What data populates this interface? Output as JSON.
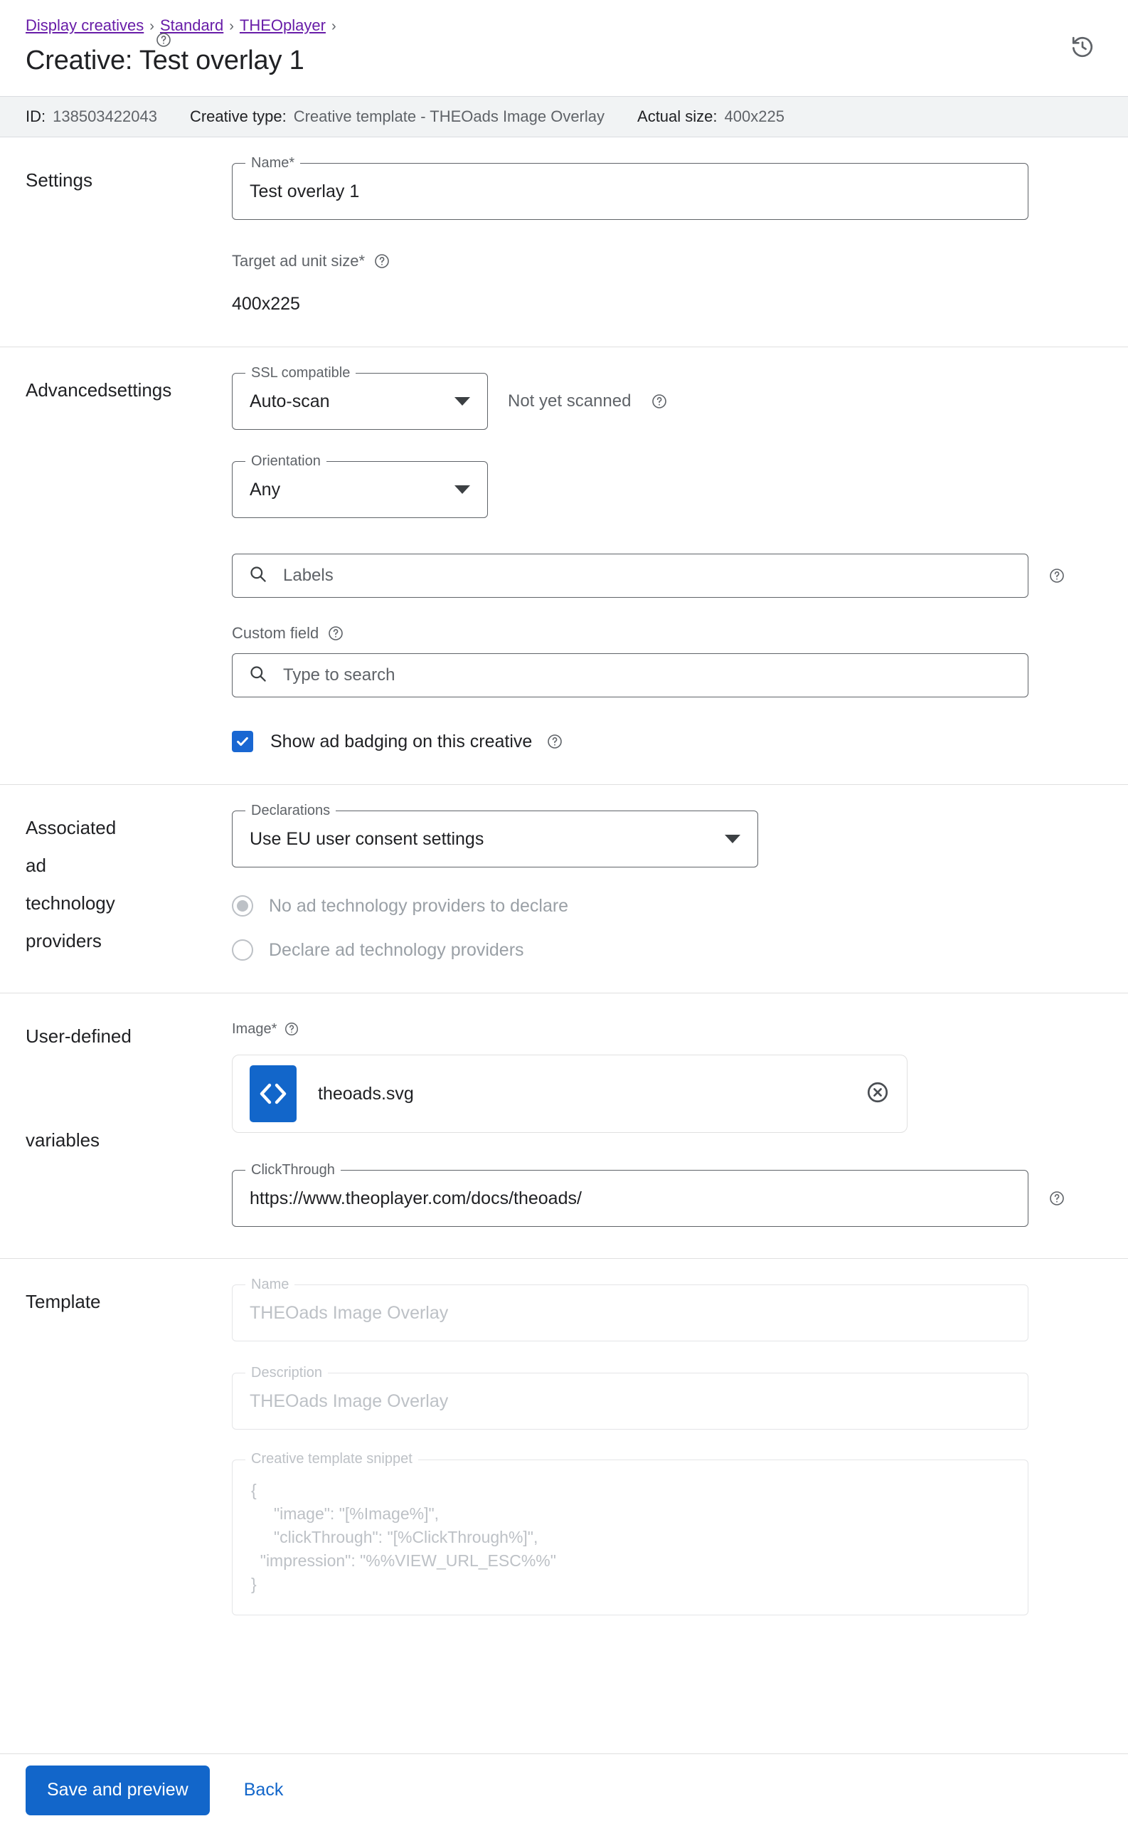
{
  "header": {
    "breadcrumb": [
      {
        "label": "Display creatives",
        "link": true
      },
      {
        "label": "Standard",
        "link": true
      },
      {
        "label": "THEOplayer",
        "link": true
      }
    ],
    "separator": "›",
    "title": "Creative: Test overlay 1",
    "history_icon": "history-icon"
  },
  "meta": [
    {
      "label": "ID:",
      "value": "138503422043"
    },
    {
      "label": "Creative type:",
      "value": "Creative template - THEOads Image Overlay"
    },
    {
      "label": "Actual size:",
      "value": "400x225"
    }
  ],
  "settings": {
    "section_title": "Settings",
    "name_label": "Name*",
    "name_value": "Test overlay 1",
    "target_size_label": "Target ad unit size*",
    "target_size_value": "400x225"
  },
  "advanced": {
    "section_title_line1": "Advanced",
    "section_title_line2": "settings",
    "ssl_label": "SSL compatible",
    "ssl_value": "Auto-scan",
    "ssl_status": "Not yet scanned",
    "orientation_label": "Orientation",
    "orientation_value": "Any",
    "labels_placeholder": "Labels",
    "custom_field_label": "Custom field",
    "custom_field_placeholder": "Type to search",
    "badging_label": "Show ad badging on this creative",
    "badging_checked": true
  },
  "providers": {
    "section_title_line1": "Associated",
    "section_title_line2": "ad",
    "section_title_line3": "technology",
    "section_title_line4": "providers",
    "declarations_label": "Declarations",
    "declarations_value": "Use EU user consent settings",
    "radio_no_declare": "No ad technology providers to declare",
    "radio_declare": "Declare ad technology providers",
    "selected": "no_declare"
  },
  "user_variables": {
    "section_title_line1": "User-defined",
    "section_title_line2": "variables",
    "image_label": "Image*",
    "image_file": "theoads.svg",
    "clickthrough_label": "ClickThrough",
    "clickthrough_value": "https://www.theoplayer.com/docs/theoads/"
  },
  "template": {
    "section_title": "Template",
    "name_label": "Name",
    "name_value": "THEOads Image Overlay",
    "description_label": "Description",
    "description_value": "THEOads Image Overlay",
    "snippet_label": "Creative template snippet",
    "snippet_code": "{\n     \"image\": \"[%Image%]\",\n     \"clickThrough\": \"[%ClickThrough%]\",\n  \"impression\": \"%%VIEW_URL_ESC%%\"\n}"
  },
  "footer": {
    "save_label": "Save and preview",
    "back_label": "Back"
  },
  "colors": {
    "accent_blue": "#1266ca",
    "checkbox_blue": "#1967d2",
    "link_purple": "#681da8",
    "meta_bar_bg": "#f1f3f4",
    "border_grey": "#5f6368",
    "disabled_grey": "#bdc1c6"
  }
}
